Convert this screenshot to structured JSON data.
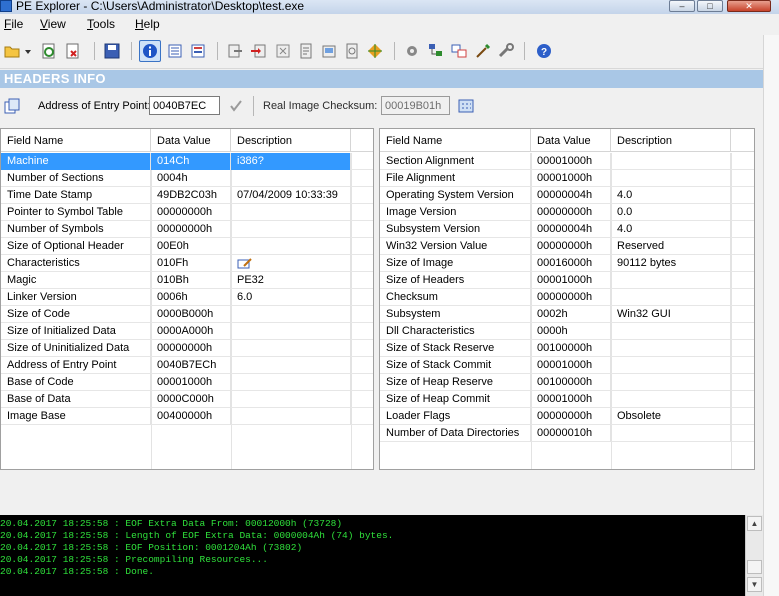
{
  "window": {
    "title": "PE Explorer - C:\\Users\\Administrator\\Desktop\\test.exe",
    "min_glyph": "–",
    "max_glyph": "□",
    "close_glyph": "✕"
  },
  "menu": [
    {
      "hotkey": "F",
      "rest": "ile"
    },
    {
      "hotkey": "V",
      "rest": "iew"
    },
    {
      "hotkey": "T",
      "rest": "ools"
    },
    {
      "hotkey": "H",
      "rest": "elp"
    }
  ],
  "toolbar_icons": [
    "open-folder-icon",
    "dropdown-arrow-icon",
    "reload-icon",
    "close-file-icon",
    "save-icon",
    "headers-info-icon",
    "data-directories-icon",
    "section-headers-icon",
    "export-icon",
    "import-icon",
    "resources-icon",
    "resource-editor-icon",
    "disassembler-icon",
    "dependency-icon",
    "plugins-icon",
    "properties-icon",
    "tree-icon",
    "syntax-icon",
    "wizard-icon",
    "tools-icon",
    "help-icon"
  ],
  "colors": {
    "banner": "#a9c7e6",
    "selection": "#3399ff",
    "log_text": "#2fe03b",
    "log_bg": "#000000"
  },
  "banner": {
    "title": "HEADERS INFO"
  },
  "address": {
    "label": "Address of Entry Point:",
    "value": "0040B7EC",
    "checksum_label": "Real Image Checksum:",
    "checksum_value": "00019B01h"
  },
  "left_table": {
    "headers": [
      "Field Name",
      "Data Value",
      "Description"
    ],
    "selected_index": 0,
    "rows": [
      {
        "name": "Machine",
        "value": "014Ch",
        "desc": "i386?"
      },
      {
        "name": "Number of Sections",
        "value": "0004h",
        "desc": ""
      },
      {
        "name": "Time Date Stamp",
        "value": "49DB2C03h",
        "desc": "07/04/2009  10:33:39"
      },
      {
        "name": "Pointer to Symbol Table",
        "value": "00000000h",
        "desc": ""
      },
      {
        "name": "Number of Symbols",
        "value": "00000000h",
        "desc": ""
      },
      {
        "name": "Size of Optional Header",
        "value": "00E0h",
        "desc": ""
      },
      {
        "name": "Characteristics",
        "value": "010Fh",
        "desc": "",
        "icon": "edit-icon"
      },
      {
        "name": "Magic",
        "value": "010Bh",
        "desc": "PE32"
      },
      {
        "name": "Linker Version",
        "value": "0006h",
        "desc": "6.0"
      },
      {
        "name": "Size of Code",
        "value": "0000B000h",
        "desc": ""
      },
      {
        "name": "Size of Initialized Data",
        "value": "0000A000h",
        "desc": ""
      },
      {
        "name": "Size of Uninitialized Data",
        "value": "00000000h",
        "desc": ""
      },
      {
        "name": "Address of Entry Point",
        "value": "0040B7ECh",
        "desc": ""
      },
      {
        "name": "Base of Code",
        "value": "00001000h",
        "desc": ""
      },
      {
        "name": "Base of Data",
        "value": "0000C000h",
        "desc": ""
      },
      {
        "name": "Image Base",
        "value": "00400000h",
        "desc": ""
      }
    ]
  },
  "right_table": {
    "headers": [
      "Field Name",
      "Data Value",
      "Description"
    ],
    "rows": [
      {
        "name": "Section Alignment",
        "value": "00001000h",
        "desc": ""
      },
      {
        "name": "File Alignment",
        "value": "00001000h",
        "desc": ""
      },
      {
        "name": "Operating System Version",
        "value": "00000004h",
        "desc": "4.0"
      },
      {
        "name": "Image Version",
        "value": "00000000h",
        "desc": "0.0"
      },
      {
        "name": "Subsystem Version",
        "value": "00000004h",
        "desc": "4.0"
      },
      {
        "name": "Win32 Version Value",
        "value": "00000000h",
        "desc": "Reserved"
      },
      {
        "name": "Size of Image",
        "value": "00016000h",
        "desc": "90112 bytes"
      },
      {
        "name": "Size of Headers",
        "value": "00001000h",
        "desc": ""
      },
      {
        "name": "Checksum",
        "value": "00000000h",
        "desc": ""
      },
      {
        "name": "Subsystem",
        "value": "0002h",
        "desc": "Win32 GUI"
      },
      {
        "name": "Dll Characteristics",
        "value": "0000h",
        "desc": ""
      },
      {
        "name": "Size of Stack Reserve",
        "value": "00100000h",
        "desc": ""
      },
      {
        "name": "Size of Stack Commit",
        "value": "00001000h",
        "desc": ""
      },
      {
        "name": "Size of Heap Reserve",
        "value": "00100000h",
        "desc": ""
      },
      {
        "name": "Size of Heap Commit",
        "value": "00001000h",
        "desc": ""
      },
      {
        "name": "Loader Flags",
        "value": "00000000h",
        "desc": "Obsolete"
      },
      {
        "name": "Number of Data Directories",
        "value": "00000010h",
        "desc": ""
      }
    ]
  },
  "log": [
    "20.04.2017 18:25:58 : EOF Extra Data From: 00012000h  (73728)",
    "20.04.2017 18:25:58 : Length of EOF Extra Data: 0000004Ah  (74) bytes.",
    "20.04.2017 18:25:58 : EOF Position: 0001204Ah  (73802)",
    "20.04.2017 18:25:58 : Precompiling Resources...",
    "20.04.2017 18:25:58 : Done."
  ]
}
